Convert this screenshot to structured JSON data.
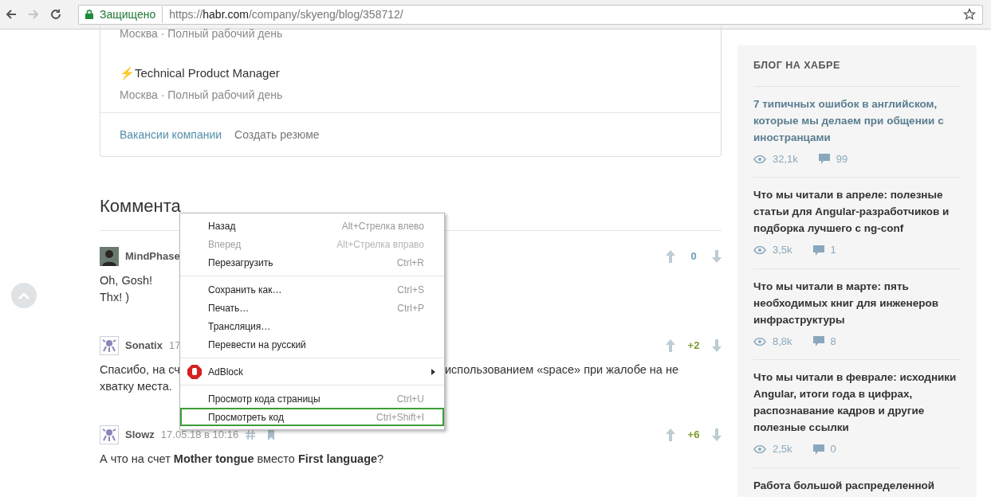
{
  "browser": {
    "back_disabled": false,
    "forward_disabled": true,
    "security_label": "Защищено",
    "url": {
      "scheme": "https://",
      "host": "habr.com",
      "path": "/company/skyeng/blog/358712/"
    }
  },
  "vacancies": {
    "items": [
      {
        "meta": "Москва · Полный рабочий день"
      },
      {
        "title": "⚡Technical Product Manager",
        "meta": "Москва · Полный рабочий день"
      }
    ],
    "links": [
      {
        "label": "Вакансии компании",
        "kind": "primary"
      },
      {
        "label": "Создать резюме",
        "kind": "secondary"
      }
    ]
  },
  "comments_heading": "Коммента",
  "comments": [
    {
      "author": "MindPhase",
      "kind": "photo",
      "lines": [
        [
          "Oh, Gosh!"
        ],
        [
          "Thx! )"
        ]
      ],
      "score": "0",
      "color": "#6c9bb8"
    },
    {
      "author": "Sonatix",
      "kind": "robot",
      "date": "17",
      "lines": [
        [
          "Спасибо, на сч",
          "использованием «space» при жалобе на не"
        ],
        [
          "хватку места."
        ]
      ],
      "score": "+2",
      "color": "#7b9b29"
    },
    {
      "author": "Slowz",
      "kind": "robot",
      "date": "17.05.18 в 10:16",
      "lines": [
        [
          "А что на счет **Mother tongue** вместо **First language**?"
        ]
      ],
      "score": "+6",
      "color": "#7b9b29",
      "actions": true
    }
  ],
  "context_menu": [
    {
      "kind": "item",
      "label": "Назад",
      "shortcut": "Alt+Стрелка влево",
      "disabled": false,
      "highlighted": false
    },
    {
      "kind": "item",
      "label": "Вперед",
      "shortcut": "Alt+Стрелка вправо",
      "disabled": true,
      "highlighted": false
    },
    {
      "kind": "item",
      "label": "Перезагрузить",
      "shortcut": "Ctrl+R",
      "disabled": false,
      "highlighted": false
    },
    {
      "kind": "separator"
    },
    {
      "kind": "item",
      "label": "Сохранить как…",
      "shortcut": "Ctrl+S",
      "disabled": false,
      "highlighted": false
    },
    {
      "kind": "item",
      "label": "Печать…",
      "shortcut": "Ctrl+P",
      "disabled": false,
      "highlighted": false
    },
    {
      "kind": "item",
      "label": "Трансляция…",
      "disabled": false,
      "highlighted": false
    },
    {
      "kind": "item",
      "label": "Перевести на русский",
      "disabled": false,
      "highlighted": false
    },
    {
      "kind": "separator"
    },
    {
      "kind": "submenu",
      "label": "AdBlock",
      "disabled": false,
      "highlighted": false
    },
    {
      "kind": "separator"
    },
    {
      "kind": "item",
      "label": "Просмотр кода страницы",
      "shortcut": "Ctrl+U",
      "disabled": false,
      "highlighted": false
    },
    {
      "kind": "item",
      "label": "Просмотреть код",
      "shortcut": "Ctrl+Shift+I",
      "disabled": false,
      "highlighted": true
    }
  ],
  "sidebar": {
    "heading": "БЛОГ НА ХАБРЕ",
    "posts": [
      {
        "title": "7 типичных ошибок в английском, которые мы делаем при общении с иностранцами",
        "highlighted": true,
        "views": "32,1k",
        "comments": "99"
      },
      {
        "title": "Что мы читали в апреле: полезные статьи для Angular-разработчиков и подборка лучшего с ng-conf",
        "highlighted": false,
        "views": "3,5k",
        "comments": "1"
      },
      {
        "title": "Что мы читали в марте: пять необходимых книг для инженеров инфраструктуры",
        "highlighted": false,
        "views": "8,8k",
        "comments": "8"
      },
      {
        "title": "Что мы читали в феврале: исходники Angular, итоги года в цифрах, распознавание кадров и другие полезные ссылки",
        "highlighted": false,
        "views": "2,5k",
        "comments": "0"
      },
      {
        "title": "Работа большой распределенной",
        "highlighted": false
      }
    ]
  }
}
